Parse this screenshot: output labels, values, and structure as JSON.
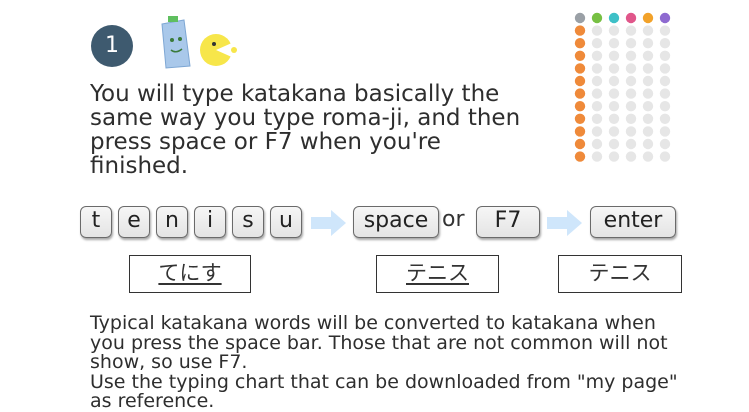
{
  "step": {
    "number": "1"
  },
  "intro": "You will type katakana basically the same way you type roma-ji, and then press space or F7 when you're finished.",
  "keys": {
    "letters": [
      "t",
      "e",
      "n",
      "i",
      "s",
      "u"
    ],
    "space": "space",
    "or": "or",
    "f7": "F7",
    "enter": "enter"
  },
  "results": {
    "hiragana": "てにす",
    "katakana_converted": "テニス",
    "katakana_final": "テニス"
  },
  "note": {
    "line1": "Typical katakana words will be converted to katakana when you press the space bar. Those that are not common will not show, so use F7.",
    "line2": "Use the typing chart that can be downloaded from \"my page\" as reference."
  },
  "colors": {
    "badge": "#3e5a6f",
    "arrow": "#cfe6fb",
    "key_border": "#6a6a6a"
  },
  "icons": {
    "mascots": "mascot-illustration",
    "chart": "katakana-typing-chart-thumbnail",
    "arrow": "right-arrow-icon"
  }
}
